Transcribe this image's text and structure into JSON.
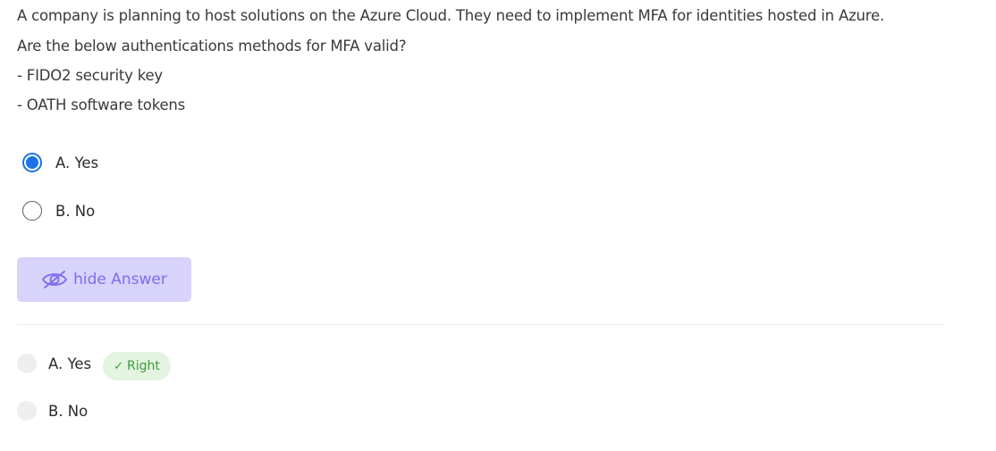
{
  "question": {
    "lines": [
      "A company is planning to host solutions on the Azure Cloud. They need to implement MFA for identities hosted in Azure.",
      "Are the below authentications methods for MFA valid?",
      "- FIDO2 security key",
      "- OATH software tokens"
    ]
  },
  "options": [
    {
      "label": "A.  Yes",
      "selected": true
    },
    {
      "label": "B.  No",
      "selected": false
    }
  ],
  "toggle_answer": {
    "label": "hide Answer",
    "icon": "eye-slash-icon",
    "background": "#d7d3fb",
    "color": "#7c6df2"
  },
  "answers": [
    {
      "label": "A.  Yes",
      "badge": "Right",
      "badge_icon": "check-icon"
    },
    {
      "label": "B.  No"
    }
  ],
  "colors": {
    "selected_radio": "#1a73e8",
    "right_badge_bg": "#e3f4e1",
    "right_badge_text": "#3f9a3a"
  }
}
